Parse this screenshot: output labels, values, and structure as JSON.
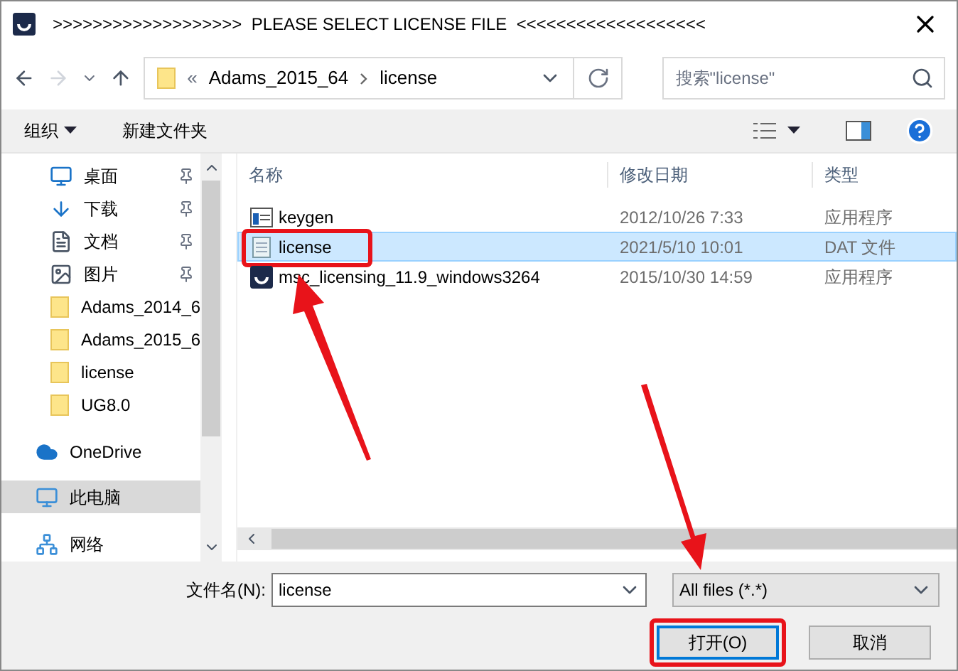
{
  "window": {
    "title": ">>>>>>>>>>>>>>>>>>>  PLEASE SELECT LICENSE FILE  <<<<<<<<<<<<<<<<<<<"
  },
  "address": {
    "overflow": "«",
    "crumbs": [
      "Adams_2015_64",
      "license"
    ]
  },
  "search": {
    "placeholder": "搜索\"license\""
  },
  "toolbar": {
    "organize": "组织",
    "new_folder": "新建文件夹"
  },
  "sidebar": {
    "items": [
      {
        "label": "桌面",
        "kind": "desktop",
        "pinned": true,
        "selected": false
      },
      {
        "label": "下载",
        "kind": "download",
        "pinned": true,
        "selected": false
      },
      {
        "label": "文档",
        "kind": "document",
        "pinned": true,
        "selected": false
      },
      {
        "label": "图片",
        "kind": "pictures",
        "pinned": true,
        "selected": false
      },
      {
        "label": "Adams_2014_6",
        "kind": "folder",
        "pinned": false,
        "selected": false
      },
      {
        "label": "Adams_2015_6",
        "kind": "folder",
        "pinned": false,
        "selected": false
      },
      {
        "label": "license",
        "kind": "folder",
        "pinned": false,
        "selected": false
      },
      {
        "label": "UG8.0",
        "kind": "folder",
        "pinned": false,
        "selected": false
      },
      {
        "label": "OneDrive",
        "kind": "cloud",
        "pinned": false,
        "selected": false
      },
      {
        "label": "此电脑",
        "kind": "computer",
        "pinned": false,
        "selected": true
      },
      {
        "label": "网络",
        "kind": "network",
        "pinned": false,
        "selected": false
      }
    ]
  },
  "table": {
    "columns": [
      "名称",
      "修改日期",
      "类型"
    ],
    "rows": [
      {
        "name": "keygen",
        "kind": "app",
        "date": "2012/10/26 7:33",
        "type": "应用程序",
        "selected": false,
        "highlighted": false
      },
      {
        "name": "license",
        "kind": "text",
        "date": "2021/5/10 10:01",
        "type": "DAT 文件",
        "selected": true,
        "highlighted": true
      },
      {
        "name": "msc_licensing_11.9_windows3264",
        "kind": "installer",
        "date": "2015/10/30 14:59",
        "type": "应用程序",
        "selected": false,
        "highlighted": false
      }
    ]
  },
  "footer": {
    "filename_label": "文件名(N):",
    "filename": "license",
    "filter": "All files (*.*)",
    "open": "打开(O)",
    "cancel": "取消",
    "open_highlighted": true
  }
}
